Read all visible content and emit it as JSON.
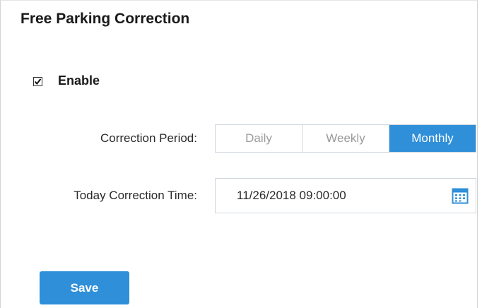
{
  "title": "Free Parking Correction",
  "enable": {
    "label": "Enable",
    "checked": true
  },
  "correction_period": {
    "label": "Correction Period:",
    "options": [
      {
        "label": "Daily",
        "selected": false
      },
      {
        "label": "Weekly",
        "selected": false
      },
      {
        "label": "Monthly",
        "selected": true
      }
    ]
  },
  "correction_time": {
    "label": "Today Correction Time:",
    "value": "11/26/2018 09:00:00",
    "icon": "calendar-icon"
  },
  "save_label": "Save",
  "colors": {
    "accent": "#2f8fd8",
    "border": "#cfd6de",
    "muted_text": "#9a9a9a"
  }
}
